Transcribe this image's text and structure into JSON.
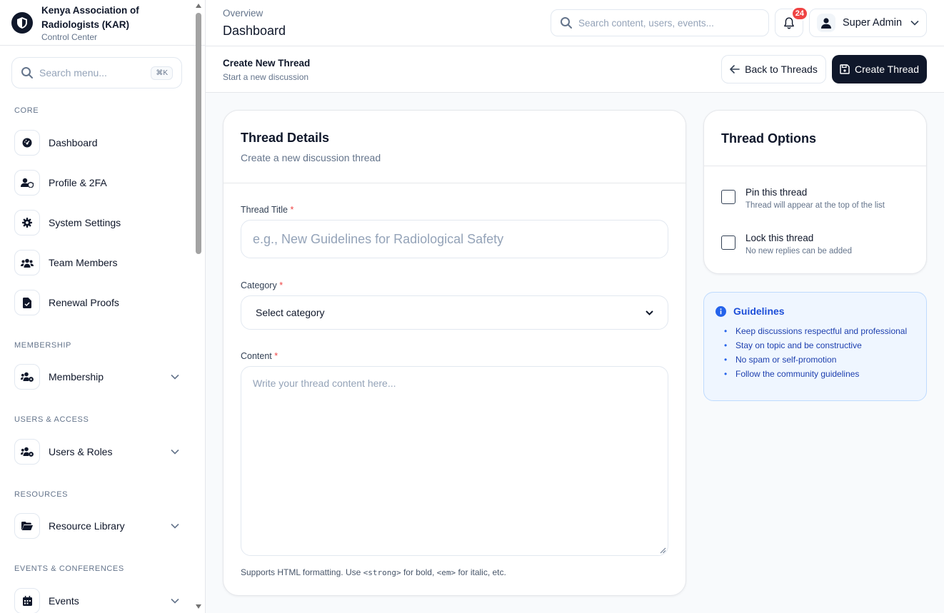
{
  "brand": {
    "org_name": "Kenya Association of Radiologists (KAR)",
    "subtitle": "Control Center"
  },
  "sidebar": {
    "search_placeholder": "Search menu...",
    "search_shortcut": "⌘K",
    "sections": {
      "core": "CORE",
      "membership": "MEMBERSHIP",
      "users_access": "USERS & ACCESS",
      "resources": "RESOURCES",
      "events": "EVENTS & CONFERENCES"
    },
    "items": [
      {
        "label": "Dashboard",
        "icon": "gauge-icon"
      },
      {
        "label": "Profile & 2FA",
        "icon": "user-shield-icon"
      },
      {
        "label": "System Settings",
        "icon": "gear-icon"
      },
      {
        "label": "Team Members",
        "icon": "users-icon"
      },
      {
        "label": "Renewal Proofs",
        "icon": "file-check-icon"
      },
      {
        "label": "Membership",
        "icon": "users-gear-icon",
        "expandable": true
      },
      {
        "label": "Users & Roles",
        "icon": "users-gear-icon",
        "expandable": true
      },
      {
        "label": "Resource Library",
        "icon": "folder-open-icon",
        "expandable": true
      },
      {
        "label": "Events",
        "icon": "calendar-icon",
        "expandable": true
      }
    ]
  },
  "header": {
    "breadcrumb_parent": "Overview",
    "breadcrumb_current": "Dashboard",
    "search_placeholder": "Search content, users, events...",
    "notifications_count": "24",
    "user_name": "Super Admin"
  },
  "page": {
    "title": "Create New Thread",
    "subtitle": "Start a new discussion",
    "back_button": "Back to Threads",
    "create_button": "Create Thread"
  },
  "form": {
    "card_title": "Thread Details",
    "card_subtitle": "Create a new discussion thread",
    "title_label": "Thread Title",
    "title_placeholder": "e.g., New Guidelines for Radiological Safety",
    "category_label": "Category",
    "category_value": "Select category",
    "content_label": "Content",
    "content_placeholder": "Write your thread content here...",
    "required_mark": "*",
    "hint_prefix": "Supports HTML formatting. Use ",
    "hint_strong": "<strong>",
    "hint_mid": " for bold, ",
    "hint_em": "<em>",
    "hint_suffix": " for italic, etc."
  },
  "options": {
    "title": "Thread Options",
    "pin_label": "Pin this thread",
    "pin_desc": "Thread will appear at the top of the list",
    "pin_checked": false,
    "lock_label": "Lock this thread",
    "lock_desc": "No new replies can be added",
    "lock_checked": false
  },
  "guidelines": {
    "title": "Guidelines",
    "items": [
      "Keep discussions respectful and professional",
      "Stay on topic and be constructive",
      "No spam or self-promotion",
      "Follow the community guidelines"
    ]
  },
  "colors": {
    "primary": "#0f172a",
    "accent_blue": "#1d4ed8",
    "badge_red": "#ef4444",
    "guide_bg": "#eff6ff"
  }
}
